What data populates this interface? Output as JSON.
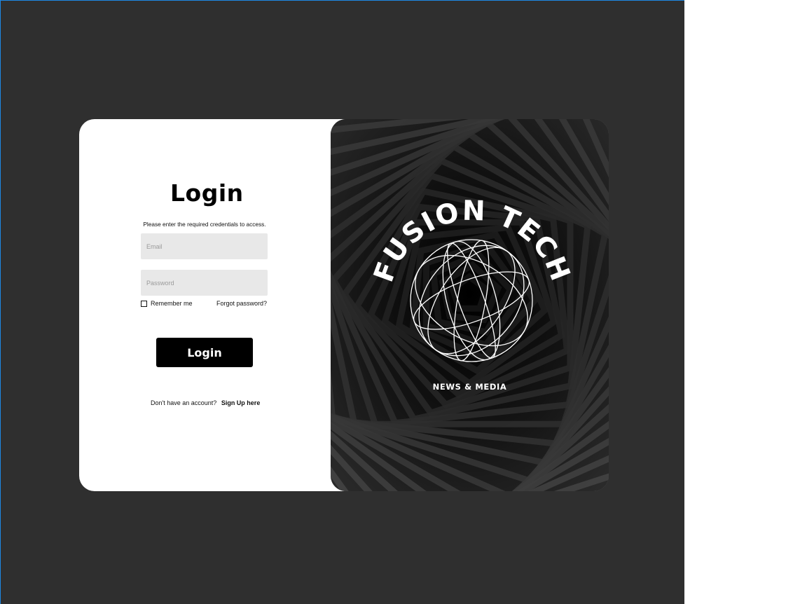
{
  "login": {
    "title": "Login",
    "subtitle": "Please enter the required credentials to access.",
    "email_placeholder": "Email",
    "password_placeholder": "Password",
    "remember_label": "Remember me",
    "forgot_label": "Forgot password?",
    "button_label": "Login",
    "signup_prompt": "Don't have an account?",
    "signup_link": "Sign Up here"
  },
  "brand": {
    "name": "FUSION TECH",
    "tagline": "NEWS & MEDIA"
  },
  "colors": {
    "backdrop": "#2f2f2f",
    "card": "#ffffff",
    "button": "#000000",
    "field": "#e8e8e8"
  }
}
